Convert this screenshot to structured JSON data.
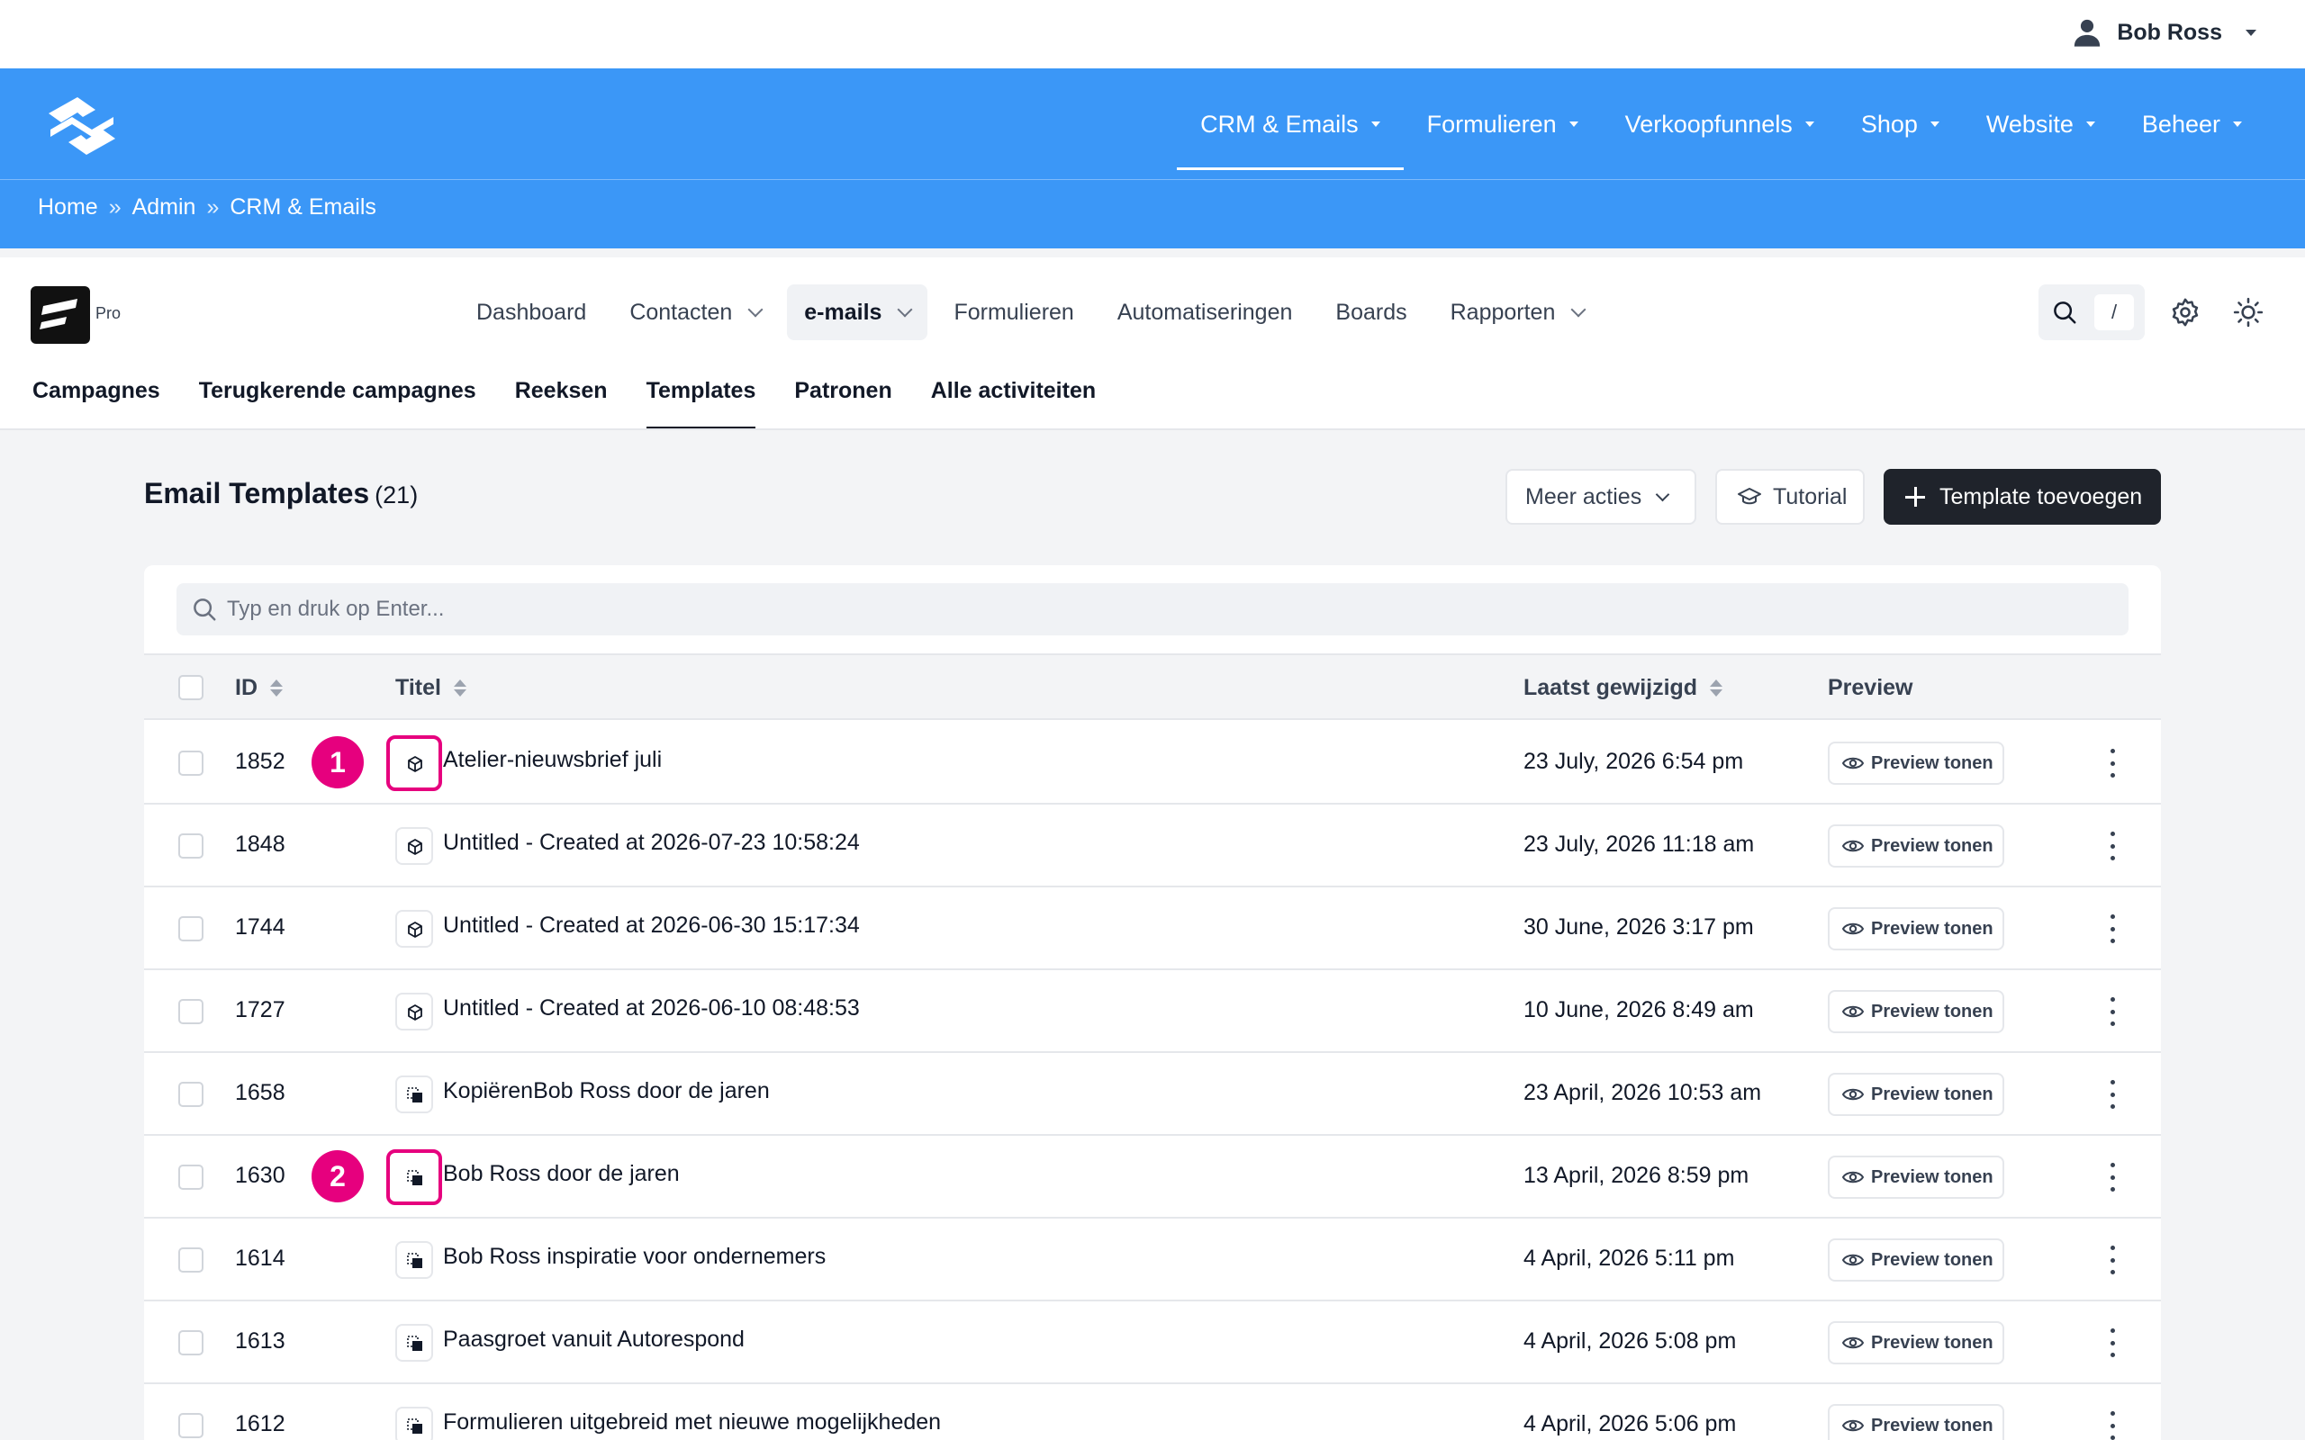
{
  "user": {
    "name": "Bob Ross"
  },
  "main_nav": [
    {
      "label": "CRM & Emails",
      "active": true
    },
    {
      "label": "Formulieren"
    },
    {
      "label": "Verkoopfunnels"
    },
    {
      "label": "Shop"
    },
    {
      "label": "Website"
    },
    {
      "label": "Beheer"
    }
  ],
  "breadcrumb": [
    "Home",
    "Admin",
    "CRM & Emails"
  ],
  "breadcrumb_sep": "»",
  "app": {
    "badge": "Pro"
  },
  "app_nav": [
    {
      "label": "Dashboard"
    },
    {
      "label": "Contacten",
      "dropdown": true
    },
    {
      "label": "e-mails",
      "dropdown": true,
      "active": true
    },
    {
      "label": "Formulieren"
    },
    {
      "label": "Automatiseringen"
    },
    {
      "label": "Boards"
    },
    {
      "label": "Rapporten",
      "dropdown": true
    }
  ],
  "search_shortcut": "/",
  "sub_nav": [
    {
      "label": "Campagnes"
    },
    {
      "label": "Terugkerende campagnes"
    },
    {
      "label": "Reeksen"
    },
    {
      "label": "Templates",
      "active": true
    },
    {
      "label": "Patronen"
    },
    {
      "label": "Alle activiteiten"
    }
  ],
  "page": {
    "title": "Email Templates",
    "count": "(21)",
    "more_actions": "Meer acties",
    "tutorial": "Tutorial",
    "add_template": "Template toevoegen"
  },
  "table": {
    "search_placeholder": "Typ en druk op Enter...",
    "columns": {
      "id": "ID",
      "title": "Titel",
      "modified": "Laatst gewijzigd",
      "preview": "Preview"
    },
    "preview_label": "Preview tonen",
    "rows": [
      {
        "id": "1852",
        "title": "Atelier-nieuwsbrief juli",
        "modified": "23 July, 2026 6:54 pm",
        "icon": "cube-icon",
        "marker": "1"
      },
      {
        "id": "1848",
        "title": "Untitled - Created at 2026-07-23 10:58:24",
        "modified": "23 July, 2026 11:18 am",
        "icon": "cube-icon"
      },
      {
        "id": "1744",
        "title": "Untitled - Created at 2026-06-30 15:17:34",
        "modified": "30 June, 2026 3:17 pm",
        "icon": "cube-icon"
      },
      {
        "id": "1727",
        "title": "Untitled - Created at 2026-06-10 08:48:53",
        "modified": "10 June, 2026 8:49 am",
        "icon": "cube-icon"
      },
      {
        "id": "1658",
        "title": "KopiërenBob Ross door de jaren",
        "modified": "23 April, 2026 10:53 am",
        "icon": "layout-icon"
      },
      {
        "id": "1630",
        "title": "Bob Ross door de jaren",
        "modified": "13 April, 2026 8:59 pm",
        "icon": "layout-icon",
        "marker": "2"
      },
      {
        "id": "1614",
        "title": "Bob Ross inspiratie voor ondernemers",
        "modified": "4 April, 2026 5:11 pm",
        "icon": "layout-icon"
      },
      {
        "id": "1613",
        "title": "Paasgroet vanuit Autorespond",
        "modified": "4 April, 2026 5:08 pm",
        "icon": "layout-icon"
      },
      {
        "id": "1612",
        "title": "Formulieren uitgebreid met nieuwe mogelijkheden",
        "modified": "4 April, 2026 5:06 pm",
        "icon": "layout-icon"
      }
    ]
  },
  "colors": {
    "brand_blue": "#3b97f7",
    "highlight": "#e6007e",
    "primary_button": "#1f232b"
  }
}
